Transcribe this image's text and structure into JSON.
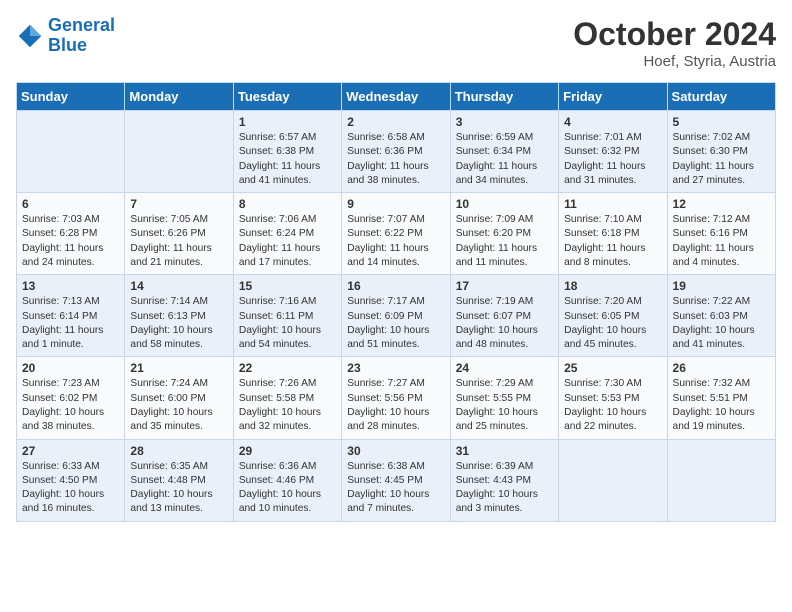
{
  "header": {
    "logo_general": "General",
    "logo_blue": "Blue",
    "month_year": "October 2024",
    "location": "Hoef, Styria, Austria"
  },
  "days_of_week": [
    "Sunday",
    "Monday",
    "Tuesday",
    "Wednesday",
    "Thursday",
    "Friday",
    "Saturday"
  ],
  "weeks": [
    [
      {
        "day": "",
        "info": ""
      },
      {
        "day": "",
        "info": ""
      },
      {
        "day": "1",
        "info": "Sunrise: 6:57 AM\nSunset: 6:38 PM\nDaylight: 11 hours and 41 minutes."
      },
      {
        "day": "2",
        "info": "Sunrise: 6:58 AM\nSunset: 6:36 PM\nDaylight: 11 hours and 38 minutes."
      },
      {
        "day": "3",
        "info": "Sunrise: 6:59 AM\nSunset: 6:34 PM\nDaylight: 11 hours and 34 minutes."
      },
      {
        "day": "4",
        "info": "Sunrise: 7:01 AM\nSunset: 6:32 PM\nDaylight: 11 hours and 31 minutes."
      },
      {
        "day": "5",
        "info": "Sunrise: 7:02 AM\nSunset: 6:30 PM\nDaylight: 11 hours and 27 minutes."
      }
    ],
    [
      {
        "day": "6",
        "info": "Sunrise: 7:03 AM\nSunset: 6:28 PM\nDaylight: 11 hours and 24 minutes."
      },
      {
        "day": "7",
        "info": "Sunrise: 7:05 AM\nSunset: 6:26 PM\nDaylight: 11 hours and 21 minutes."
      },
      {
        "day": "8",
        "info": "Sunrise: 7:06 AM\nSunset: 6:24 PM\nDaylight: 11 hours and 17 minutes."
      },
      {
        "day": "9",
        "info": "Sunrise: 7:07 AM\nSunset: 6:22 PM\nDaylight: 11 hours and 14 minutes."
      },
      {
        "day": "10",
        "info": "Sunrise: 7:09 AM\nSunset: 6:20 PM\nDaylight: 11 hours and 11 minutes."
      },
      {
        "day": "11",
        "info": "Sunrise: 7:10 AM\nSunset: 6:18 PM\nDaylight: 11 hours and 8 minutes."
      },
      {
        "day": "12",
        "info": "Sunrise: 7:12 AM\nSunset: 6:16 PM\nDaylight: 11 hours and 4 minutes."
      }
    ],
    [
      {
        "day": "13",
        "info": "Sunrise: 7:13 AM\nSunset: 6:14 PM\nDaylight: 11 hours and 1 minute."
      },
      {
        "day": "14",
        "info": "Sunrise: 7:14 AM\nSunset: 6:13 PM\nDaylight: 10 hours and 58 minutes."
      },
      {
        "day": "15",
        "info": "Sunrise: 7:16 AM\nSunset: 6:11 PM\nDaylight: 10 hours and 54 minutes."
      },
      {
        "day": "16",
        "info": "Sunrise: 7:17 AM\nSunset: 6:09 PM\nDaylight: 10 hours and 51 minutes."
      },
      {
        "day": "17",
        "info": "Sunrise: 7:19 AM\nSunset: 6:07 PM\nDaylight: 10 hours and 48 minutes."
      },
      {
        "day": "18",
        "info": "Sunrise: 7:20 AM\nSunset: 6:05 PM\nDaylight: 10 hours and 45 minutes."
      },
      {
        "day": "19",
        "info": "Sunrise: 7:22 AM\nSunset: 6:03 PM\nDaylight: 10 hours and 41 minutes."
      }
    ],
    [
      {
        "day": "20",
        "info": "Sunrise: 7:23 AM\nSunset: 6:02 PM\nDaylight: 10 hours and 38 minutes."
      },
      {
        "day": "21",
        "info": "Sunrise: 7:24 AM\nSunset: 6:00 PM\nDaylight: 10 hours and 35 minutes."
      },
      {
        "day": "22",
        "info": "Sunrise: 7:26 AM\nSunset: 5:58 PM\nDaylight: 10 hours and 32 minutes."
      },
      {
        "day": "23",
        "info": "Sunrise: 7:27 AM\nSunset: 5:56 PM\nDaylight: 10 hours and 28 minutes."
      },
      {
        "day": "24",
        "info": "Sunrise: 7:29 AM\nSunset: 5:55 PM\nDaylight: 10 hours and 25 minutes."
      },
      {
        "day": "25",
        "info": "Sunrise: 7:30 AM\nSunset: 5:53 PM\nDaylight: 10 hours and 22 minutes."
      },
      {
        "day": "26",
        "info": "Sunrise: 7:32 AM\nSunset: 5:51 PM\nDaylight: 10 hours and 19 minutes."
      }
    ],
    [
      {
        "day": "27",
        "info": "Sunrise: 6:33 AM\nSunset: 4:50 PM\nDaylight: 10 hours and 16 minutes."
      },
      {
        "day": "28",
        "info": "Sunrise: 6:35 AM\nSunset: 4:48 PM\nDaylight: 10 hours and 13 minutes."
      },
      {
        "day": "29",
        "info": "Sunrise: 6:36 AM\nSunset: 4:46 PM\nDaylight: 10 hours and 10 minutes."
      },
      {
        "day": "30",
        "info": "Sunrise: 6:38 AM\nSunset: 4:45 PM\nDaylight: 10 hours and 7 minutes."
      },
      {
        "day": "31",
        "info": "Sunrise: 6:39 AM\nSunset: 4:43 PM\nDaylight: 10 hours and 3 minutes."
      },
      {
        "day": "",
        "info": ""
      },
      {
        "day": "",
        "info": ""
      }
    ]
  ]
}
